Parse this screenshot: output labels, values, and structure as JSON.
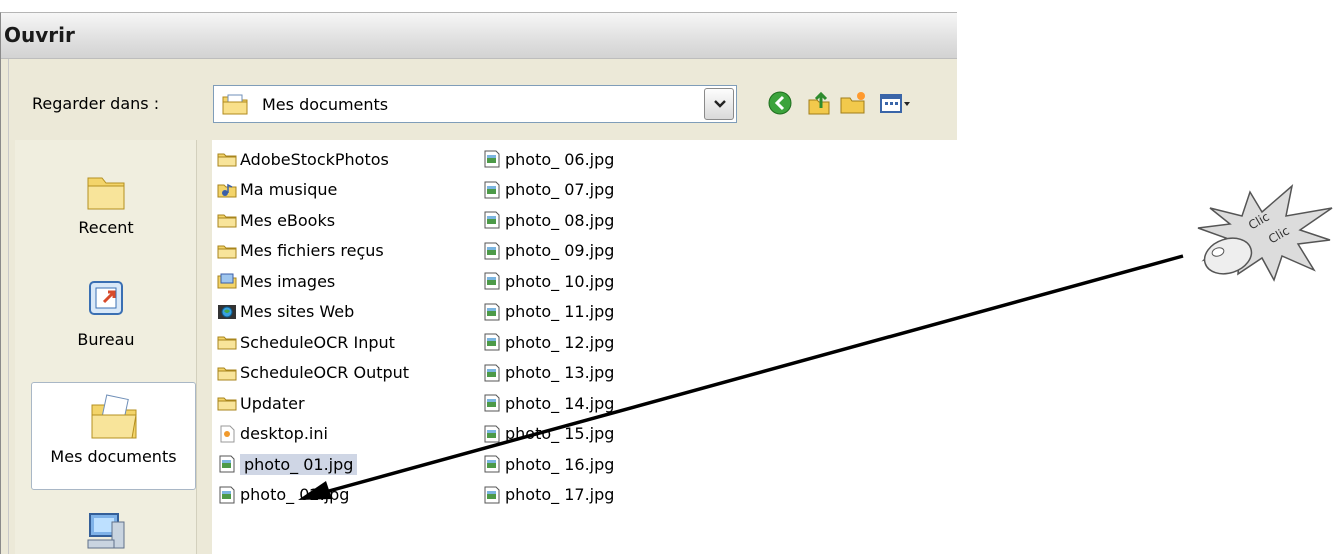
{
  "dialog": {
    "title": "Ouvrir",
    "lookin": {
      "label": "Regarder dans :",
      "value": "Mes documents"
    },
    "toolbar": [
      "back-icon",
      "up-folder-icon",
      "new-folder-icon",
      "view-menu-icon"
    ],
    "places": [
      {
        "label": "Recent",
        "icon": "recent-icon"
      },
      {
        "label": "Bureau",
        "icon": "desktop-icon"
      },
      {
        "label": "Mes documents",
        "icon": "my-documents-icon",
        "selected": true
      },
      {
        "label": "",
        "icon": "my-computer-icon"
      }
    ],
    "files_col1": [
      {
        "name": "AdobeStockPhotos",
        "type": "folder"
      },
      {
        "name": "Ma musique",
        "type": "music-folder"
      },
      {
        "name": "Mes eBooks",
        "type": "folder"
      },
      {
        "name": "Mes fichiers reçus",
        "type": "folder"
      },
      {
        "name": "Mes images",
        "type": "pictures-folder"
      },
      {
        "name": "Mes sites Web",
        "type": "web-folder"
      },
      {
        "name": "ScheduleOCR Input",
        "type": "folder"
      },
      {
        "name": "ScheduleOCR Output",
        "type": "folder"
      },
      {
        "name": "Updater",
        "type": "folder"
      },
      {
        "name": "desktop.ini",
        "type": "ini"
      },
      {
        "name": "photo_ 01.jpg",
        "type": "image",
        "selected": true
      },
      {
        "name": "photo_ 02.jpg",
        "type": "image"
      }
    ],
    "files_col2": [
      {
        "name": "photo_ 06.jpg",
        "type": "image"
      },
      {
        "name": "photo_ 07.jpg",
        "type": "image"
      },
      {
        "name": "photo_ 08.jpg",
        "type": "image"
      },
      {
        "name": "photo_ 09.jpg",
        "type": "image"
      },
      {
        "name": "photo_ 10.jpg",
        "type": "image"
      },
      {
        "name": "photo_ 11.jpg",
        "type": "image"
      },
      {
        "name": "photo_ 12.jpg",
        "type": "image"
      },
      {
        "name": "photo_ 13.jpg",
        "type": "image"
      },
      {
        "name": "photo_ 14.jpg",
        "type": "image"
      },
      {
        "name": "photo_ 15.jpg",
        "type": "image"
      },
      {
        "name": "photo_ 16.jpg",
        "type": "image"
      },
      {
        "name": "photo_ 17.jpg",
        "type": "image"
      }
    ]
  },
  "annotation": {
    "badge_line1": "Clic",
    "badge_line2": "Clic",
    "icon": "mouse-icon"
  }
}
